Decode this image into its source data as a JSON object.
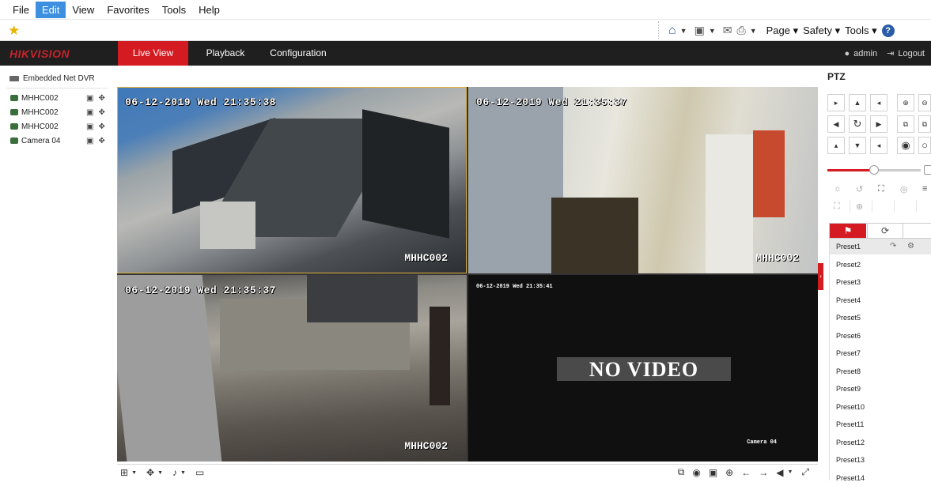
{
  "browser": {
    "menu": [
      "File",
      "Edit",
      "View",
      "Favorites",
      "Tools",
      "Help"
    ],
    "commands": {
      "page": "Page",
      "safety": "Safety",
      "tools": "Tools",
      "help": "?"
    }
  },
  "nav": {
    "brand": "HIKVISION",
    "tabs": [
      "Live View",
      "Playback",
      "Configuration"
    ],
    "user": "admin",
    "logout": "Logout"
  },
  "tree": {
    "root": "Embedded Net DVR",
    "cameras": [
      "MHHC002",
      "MHHC002",
      "MHHC002",
      "Camera 04"
    ]
  },
  "views": [
    {
      "date": "06-12-2019 Wed 21:35:38",
      "name": "MHHC002"
    },
    {
      "date": "06-12-2019 Wed 21:35:37",
      "name": "MHHC002"
    },
    {
      "date": "06-12-2019 Wed 21:35:37",
      "name": "MHHC002"
    },
    {
      "date": "06-12-2019 Wed 21:35:41",
      "name": "Camera 04",
      "no_video": "NO VIDEO"
    }
  ],
  "ptz": {
    "title": "PTZ",
    "presets": [
      "Preset1",
      "Preset2",
      "Preset3",
      "Preset4",
      "Preset5",
      "Preset6",
      "Preset7",
      "Preset8",
      "Preset9",
      "Preset10",
      "Preset11",
      "Preset12",
      "Preset13",
      "Preset14"
    ],
    "speed_fraction": 0.5
  }
}
